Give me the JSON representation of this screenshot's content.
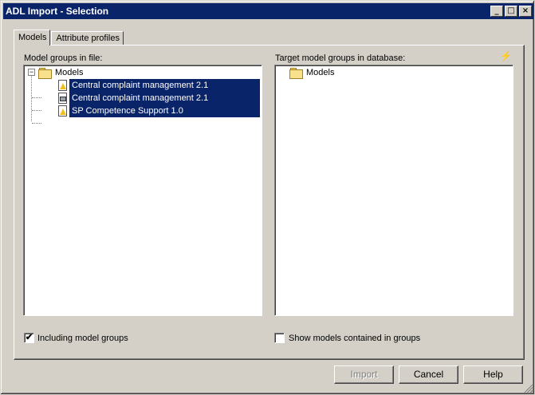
{
  "window": {
    "title": "ADL Import - Selection"
  },
  "titlebar_buttons": {
    "minimize": "_",
    "maximize": "□",
    "close": "×"
  },
  "tabs": [
    {
      "label": "Models",
      "active": true
    },
    {
      "label": "Attribute profiles",
      "active": false
    }
  ],
  "left_panel": {
    "label": "Model groups in file:",
    "tree": {
      "root": {
        "label": "Models",
        "expander": "−"
      },
      "children": [
        {
          "label": "Central complaint management 2.1",
          "icon": "model-triangle-icon",
          "selected": true
        },
        {
          "label": "Central complaint management 2.1",
          "icon": "model-box-icon",
          "selected": true
        },
        {
          "label": "SP Competence Support 1.0",
          "icon": "model-triangle-icon",
          "selected": true
        }
      ]
    }
  },
  "right_panel": {
    "label": "Target model groups in database:",
    "refresh_icon": "⚡",
    "tree": {
      "root": {
        "label": "Models"
      }
    }
  },
  "options": {
    "including_groups": {
      "label": "Including model groups",
      "checked": true,
      "mark": "✔"
    },
    "show_models": {
      "label": "Show models contained in groups",
      "checked": false,
      "mark": ""
    }
  },
  "buttons": {
    "import": {
      "label": "Import",
      "enabled": false
    },
    "cancel": {
      "label": "Cancel",
      "enabled": true
    },
    "help": {
      "label": "Help",
      "enabled": true
    }
  }
}
